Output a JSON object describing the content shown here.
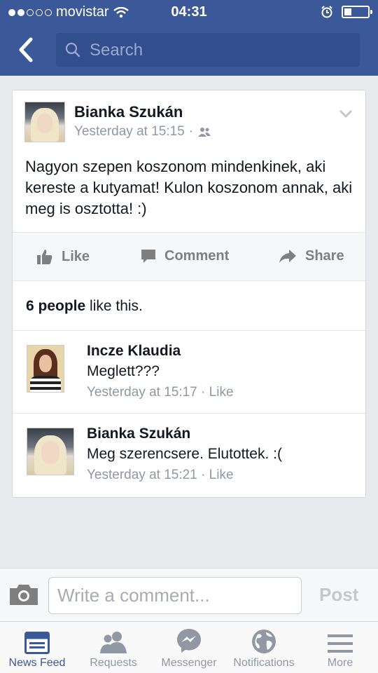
{
  "status": {
    "carrier": "movistar",
    "time": "04:31"
  },
  "nav": {
    "search_placeholder": "Search"
  },
  "post": {
    "author": "Bianka Szukán",
    "timestamp": "Yesterday at 15:15",
    "separator": "·",
    "text": "Nagyon szepen koszonom mindenkinek, aki kereste a kutyamat! Kulon koszonom annak, aki meg is osztotta! :)",
    "actions": {
      "like": "Like",
      "comment": "Comment",
      "share": "Share"
    },
    "likes_count": "6 people",
    "likes_suffix": " like this."
  },
  "comments": [
    {
      "author": "Incze Klaudia",
      "text": "Meglett???",
      "timestamp": "Yesterday at 15:17",
      "like": "Like"
    },
    {
      "author": "Bianka Szukán",
      "text": "Meg szerencsere. Elutottek. :(",
      "timestamp": "Yesterday at 15:21",
      "like": "Like"
    }
  ],
  "composer": {
    "placeholder": "Write a comment...",
    "post_label": "Post"
  },
  "tabs": [
    {
      "label": "News Feed",
      "icon": "news-feed-icon"
    },
    {
      "label": "Requests",
      "icon": "friend-requests-icon"
    },
    {
      "label": "Messenger",
      "icon": "messenger-icon"
    },
    {
      "label": "Notifications",
      "icon": "globe-icon"
    },
    {
      "label": "More",
      "icon": "menu-icon"
    }
  ],
  "colors": {
    "brand_blue": "#3b5998",
    "background": "#e9eaed",
    "meta_gray": "#9197a3"
  }
}
